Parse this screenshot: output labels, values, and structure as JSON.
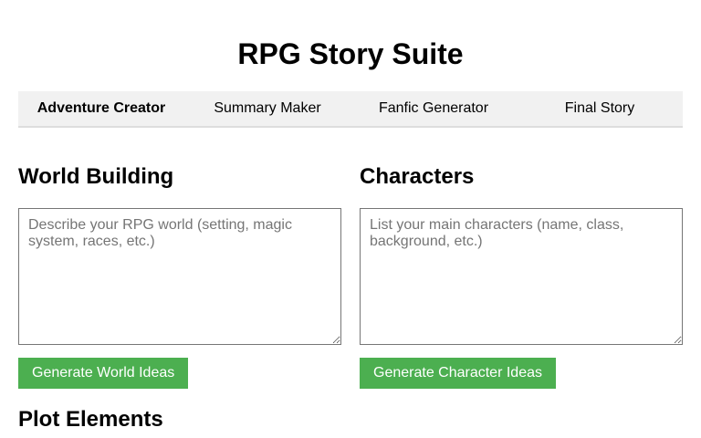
{
  "app": {
    "title": "RPG Story Suite"
  },
  "tabs": [
    {
      "label": "Adventure Creator",
      "active": true
    },
    {
      "label": "Summary Maker",
      "active": false
    },
    {
      "label": "Fanfic Generator",
      "active": false
    },
    {
      "label": "Final Story",
      "active": false
    }
  ],
  "world_building": {
    "heading": "World Building",
    "placeholder": "Describe your RPG world (setting, magic system, races, etc.)",
    "value": "",
    "button_label": "Generate World Ideas"
  },
  "characters": {
    "heading": "Characters",
    "placeholder": "List your main characters (name, class, background, etc.)",
    "value": "",
    "button_label": "Generate Character Ideas"
  },
  "plot_elements": {
    "heading": "Plot Elements"
  },
  "colors": {
    "accent_button": "#4caf50",
    "tabbar_background": "#f1f1f1"
  }
}
